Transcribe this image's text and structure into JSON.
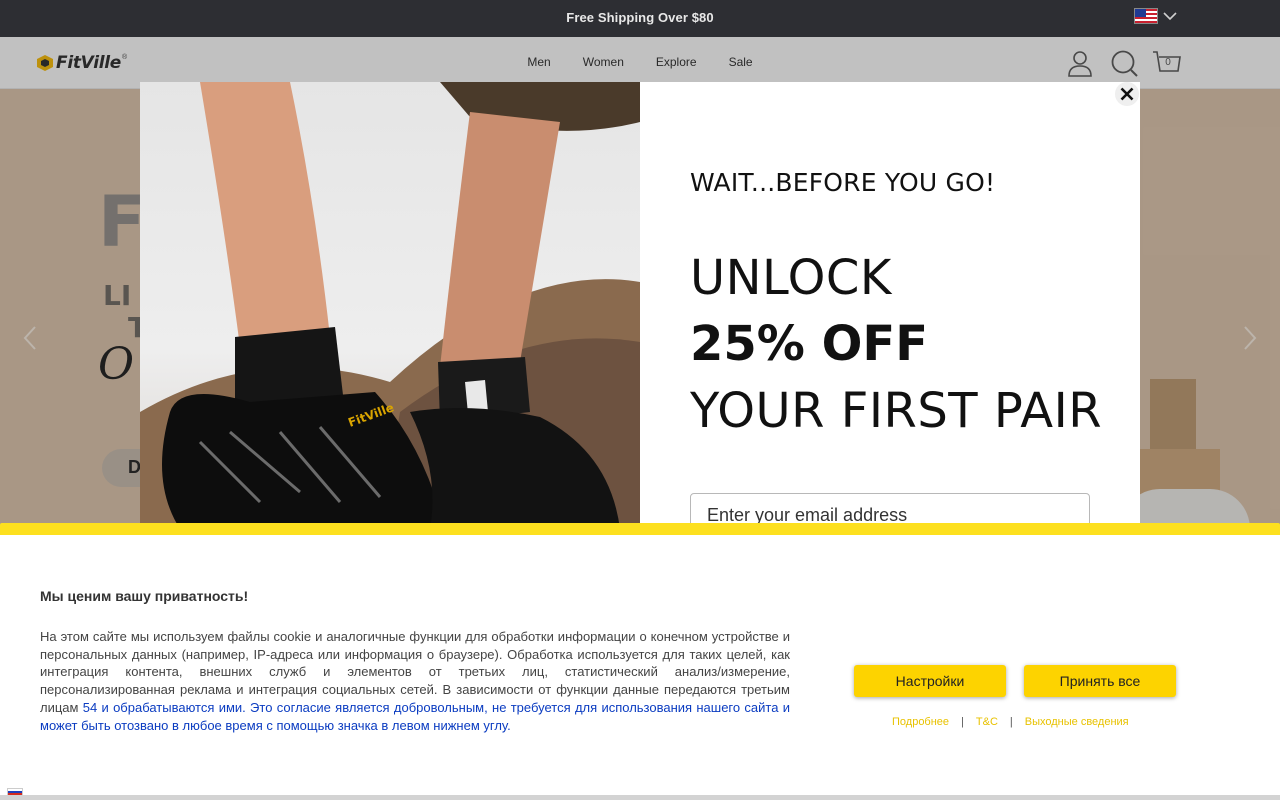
{
  "announcement": {
    "text": "Free Shipping Over $80",
    "country_flag": "us-flag-icon"
  },
  "header": {
    "logo_text": "FitVille",
    "logo_reg": "®",
    "nav": [
      "Men",
      "Women",
      "Explore",
      "Sale"
    ],
    "cart_count": "0",
    "icons": [
      "account-icon",
      "search-icon",
      "cart-icon"
    ]
  },
  "hero": {
    "headline": "F",
    "line2": "LI",
    "line3": "T",
    "script": "O",
    "cta": "D"
  },
  "modal": {
    "wait": "WAIT...BEFORE YOU GO!",
    "unlock": "UNLOCK",
    "offer": "25% OFF",
    "first_pair": "YOUR FIRST PAIR",
    "email_placeholder": "Enter your email address",
    "shoe_brand": "FitVille"
  },
  "cookie": {
    "title": "Мы ценим вашу приватность!",
    "body_plain": "На этом сайте мы используем файлы cookie и аналогичные функции для обработки информации о конечном устройстве и персональных данных (например, IP-адреса или информация о браузере). Обработка используется для таких целей, как интеграция контента, внешних служб и элементов от третьих лиц, статистический анализ/измерение, персонализированная реклама и интеграция социальных сетей. В зависимости от функции данные передаются третьим лицам ",
    "body_link": "54 и обрабатываются ими. Это согласие является добровольным, не требуется для использования нашего сайта и может быть отозвано в любое время с помощью значка в левом нижнем углу.",
    "settings_button": "Настройки",
    "accept_button": "Принять все",
    "links": [
      "Подробнее",
      "T&C",
      "Выходные сведения"
    ],
    "separator": "|"
  },
  "colors": {
    "accent_yellow": "#fdd300",
    "banner_bar": "#2d2e33",
    "link_blue": "#0b3cc1"
  }
}
